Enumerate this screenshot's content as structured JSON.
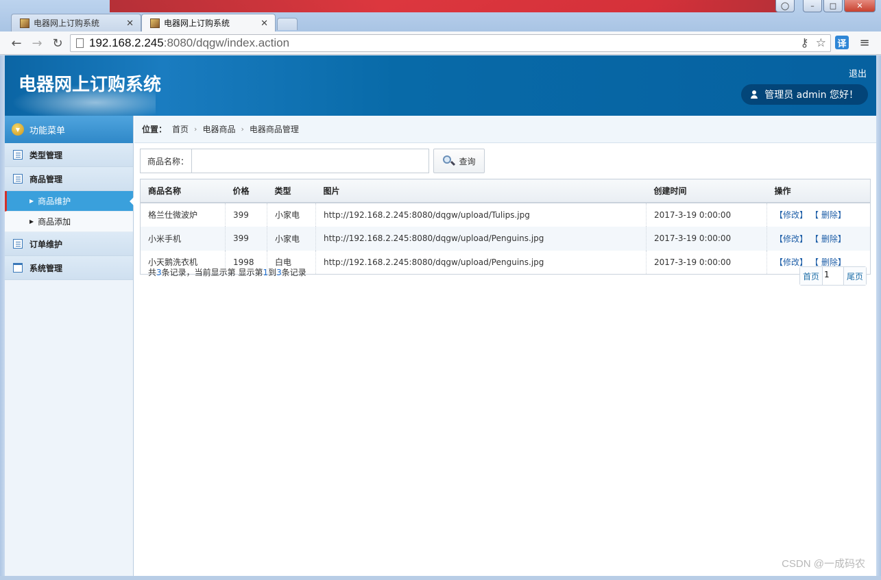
{
  "browser": {
    "tabs": [
      {
        "title": "电器网上订购系统",
        "active": false
      },
      {
        "title": "电器网上订购系统",
        "active": true
      }
    ],
    "url_host": "192.168.2.245",
    "url_rest": ":8080/dqgw/index.action",
    "translate_label": "译"
  },
  "header": {
    "title": "电器网上订购系统",
    "logout": "退出",
    "user_greeting": "管理员 admin 您好！"
  },
  "sidebar": {
    "title": "功能菜单",
    "items": [
      {
        "label": "类型管理",
        "icon": "list-icon"
      },
      {
        "label": "商品管理",
        "icon": "list-icon",
        "children": [
          {
            "label": "商品维护",
            "active": true
          },
          {
            "label": "商品添加",
            "active": false
          }
        ]
      },
      {
        "label": "订单维护",
        "icon": "list-icon"
      },
      {
        "label": "系统管理",
        "icon": "calendar-icon"
      }
    ]
  },
  "breadcrumb": {
    "label": "位置：",
    "items": [
      "首页",
      "电器商品",
      "电器商品管理"
    ]
  },
  "search": {
    "label": "商品名称：",
    "value": "",
    "button": "查询"
  },
  "table": {
    "columns": [
      "商品名称",
      "价格",
      "类型",
      "图片",
      "创建时间",
      "操作"
    ],
    "rows": [
      {
        "name": "格兰仕微波炉",
        "price": "399",
        "type": "小家电",
        "image": "http://192.168.2.245:8080/dqgw/upload/Tulips.jpg",
        "created": "2017-3-19 0:00:00"
      },
      {
        "name": "小米手机",
        "price": "399",
        "type": "小家电",
        "image": "http://192.168.2.245:8080/dqgw/upload/Penguins.jpg",
        "created": "2017-3-19 0:00:00"
      },
      {
        "name": "小天鹅洗衣机",
        "price": "1998",
        "type": "白电",
        "image": "http://192.168.2.245:8080/dqgw/upload/Penguins.jpg",
        "created": "2017-3-19 0:00:00"
      }
    ],
    "edit_label": "【修改】",
    "delete_label": "【 删除】"
  },
  "summary": {
    "prefix": "共",
    "total": "3",
    "middle": "条记录，当前显示第  显示第",
    "from": "1",
    "to_label": "到",
    "to": "3",
    "suffix": "条记录"
  },
  "pager": {
    "first": "首页",
    "current": "1",
    "last": "尾页"
  },
  "watermark": "CSDN @一成码农",
  "colors": {
    "header_blue": "#0b65a4",
    "active_menu": "#3aa0dc",
    "link": "#1f5fa8"
  }
}
